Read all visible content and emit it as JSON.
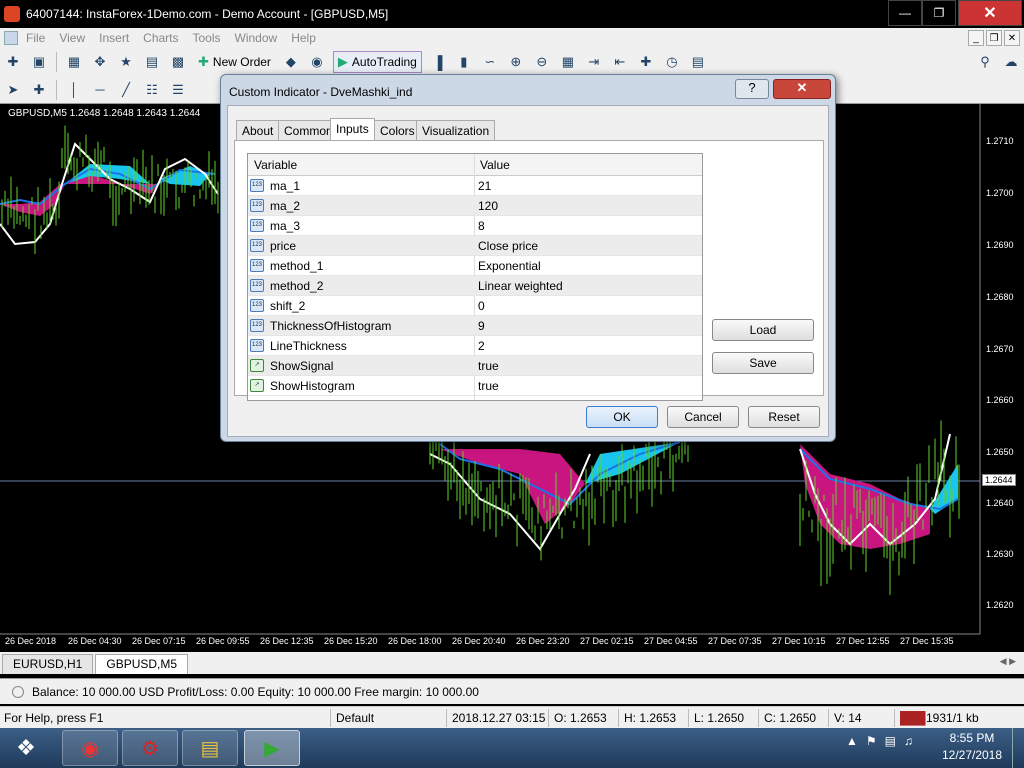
{
  "window": {
    "title": "64007144: InstaForex-1Demo.com - Demo Account - [GBPUSD,M5]",
    "min_icon": "minimize-icon",
    "max_icon": "maximize-icon",
    "close_icon": "close-icon"
  },
  "menu": {
    "items": [
      "File",
      "View",
      "Insert",
      "Charts",
      "Tools",
      "Window",
      "Help"
    ]
  },
  "toolbar": {
    "new_order": "New Order",
    "auto_trading": "AutoTrading"
  },
  "chart": {
    "label": "GBPUSD,M5  1.2648 1.2648 1.2643 1.2644",
    "current_price": "1.2644",
    "price_ticks": [
      "1.2710",
      "1.2700",
      "1.2690",
      "1.2680",
      "1.2670",
      "1.2660",
      "1.2650",
      "1.2640",
      "1.2630",
      "1.2620"
    ],
    "time_ticks": [
      "26 Dec 2018",
      "26 Dec 04:30",
      "26 Dec 07:15",
      "26 Dec 09:55",
      "26 Dec 12:35",
      "26 Dec 15:20",
      "26 Dec 18:00",
      "26 Dec 20:40",
      "26 Dec 23:20",
      "27 Dec 02:15",
      "27 Dec 04:55",
      "27 Dec 07:35",
      "27 Dec 10:15",
      "27 Dec 12:55",
      "27 Dec 15:35"
    ],
    "colors": {
      "histogram_bear": "#c8157f",
      "histogram_bull": "#19c5ef",
      "signal_line": "#ffffff",
      "candles": "#5fd42a",
      "ma_line": "#1a73e8",
      "ma_line_2": "#6bd12b"
    }
  },
  "chart_tabs": [
    "EURUSD,H1",
    "GBPUSD,M5"
  ],
  "terminal": {
    "text": "Balance: 10 000.00 USD  Profit/Loss: 0.00  Equity: 10 000.00  Free margin: 10 000.00"
  },
  "status": {
    "help": "For Help, press F1",
    "profile": "Default",
    "datetime": "2018.12.27 03:15",
    "open": "O: 1.2653",
    "high": "H: 1.2653",
    "low": "L: 1.2650",
    "close": "C: 1.2650",
    "volume": "V: 14",
    "traffic": "1931/1 kb"
  },
  "taskbar": {
    "clock_time": "8:55 PM",
    "clock_date": "12/27/2018"
  },
  "dialog": {
    "title": "Custom Indicator - DveMashki_ind",
    "help": "?",
    "close": "✕",
    "tabs": [
      "About",
      "Common",
      "Inputs",
      "Colors",
      "Visualization"
    ],
    "active_tab": "Inputs",
    "columns": {
      "variable": "Variable",
      "value": "Value"
    },
    "params": [
      {
        "name": "ma_1",
        "value": "21",
        "icon": "numeric-param-icon"
      },
      {
        "name": "ma_2",
        "value": "120",
        "icon": "numeric-param-icon"
      },
      {
        "name": "ma_3",
        "value": "8",
        "icon": "numeric-param-icon"
      },
      {
        "name": "price",
        "value": "Close price",
        "icon": "numeric-param-icon"
      },
      {
        "name": "method_1",
        "value": "Exponential",
        "icon": "numeric-param-icon"
      },
      {
        "name": "method_2",
        "value": "Linear weighted",
        "icon": "numeric-param-icon"
      },
      {
        "name": "shift_2",
        "value": "0",
        "icon": "numeric-param-icon"
      },
      {
        "name": "ThicknessOfHistogram",
        "value": "9",
        "icon": "numeric-param-icon"
      },
      {
        "name": "LineThickness",
        "value": "2",
        "icon": "numeric-param-icon"
      },
      {
        "name": "ShowSignal",
        "value": "true",
        "icon": "bool-param-icon"
      },
      {
        "name": "ShowHistogram",
        "value": "true",
        "icon": "bool-param-icon"
      }
    ],
    "buttons": {
      "load": "Load",
      "save": "Save",
      "ok": "OK",
      "cancel": "Cancel",
      "reset": "Reset"
    }
  }
}
